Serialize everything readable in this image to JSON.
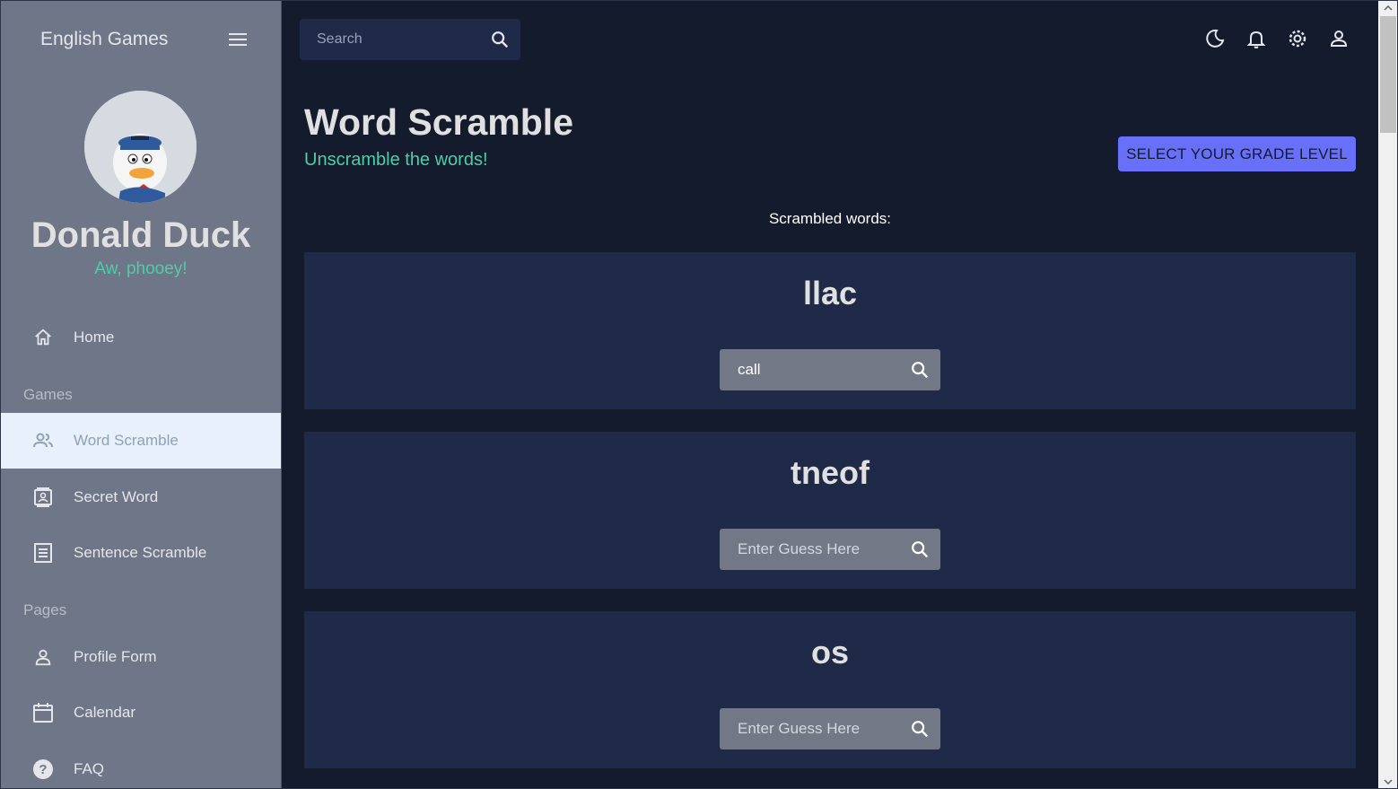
{
  "sidebar": {
    "app_title": "English Games",
    "profile": {
      "name": "Donald Duck",
      "tagline": "Aw, phooey!"
    },
    "home_label": "Home",
    "games_section": "Games",
    "games": [
      {
        "label": "Word Scramble",
        "icon": "people-icon",
        "active": true
      },
      {
        "label": "Secret Word",
        "icon": "contact-card-icon"
      },
      {
        "label": "Sentence Scramble",
        "icon": "receipt-icon"
      }
    ],
    "pages_section": "Pages",
    "pages": [
      {
        "label": "Profile Form",
        "icon": "person-icon"
      },
      {
        "label": "Calendar",
        "icon": "calendar-icon"
      },
      {
        "label": "FAQ",
        "icon": "help-icon"
      }
    ]
  },
  "topbar": {
    "search_placeholder": "Search",
    "icons": [
      "dark-mode-icon",
      "notifications-icon",
      "settings-icon",
      "account-icon"
    ]
  },
  "header": {
    "title": "Word Scramble",
    "subtitle": "Unscramble the words!",
    "grade_button": "SELECT YOUR GRADE LEVEL"
  },
  "scrambled_label": "Scrambled words:",
  "words": [
    {
      "scrambled": "llac",
      "guess_value": "call",
      "placeholder": "Enter Guess Here"
    },
    {
      "scrambled": "tneof",
      "guess_value": "",
      "placeholder": "Enter Guess Here"
    },
    {
      "scrambled": "os",
      "guess_value": "",
      "placeholder": "Enter Guess Here"
    }
  ],
  "colors": {
    "background": "#141b2d",
    "card": "#1f2a48",
    "sidebar": "#6f7687",
    "accent_green": "#4cceac",
    "accent_purple": "#6870fa",
    "active_item": "#e8f1fb"
  }
}
